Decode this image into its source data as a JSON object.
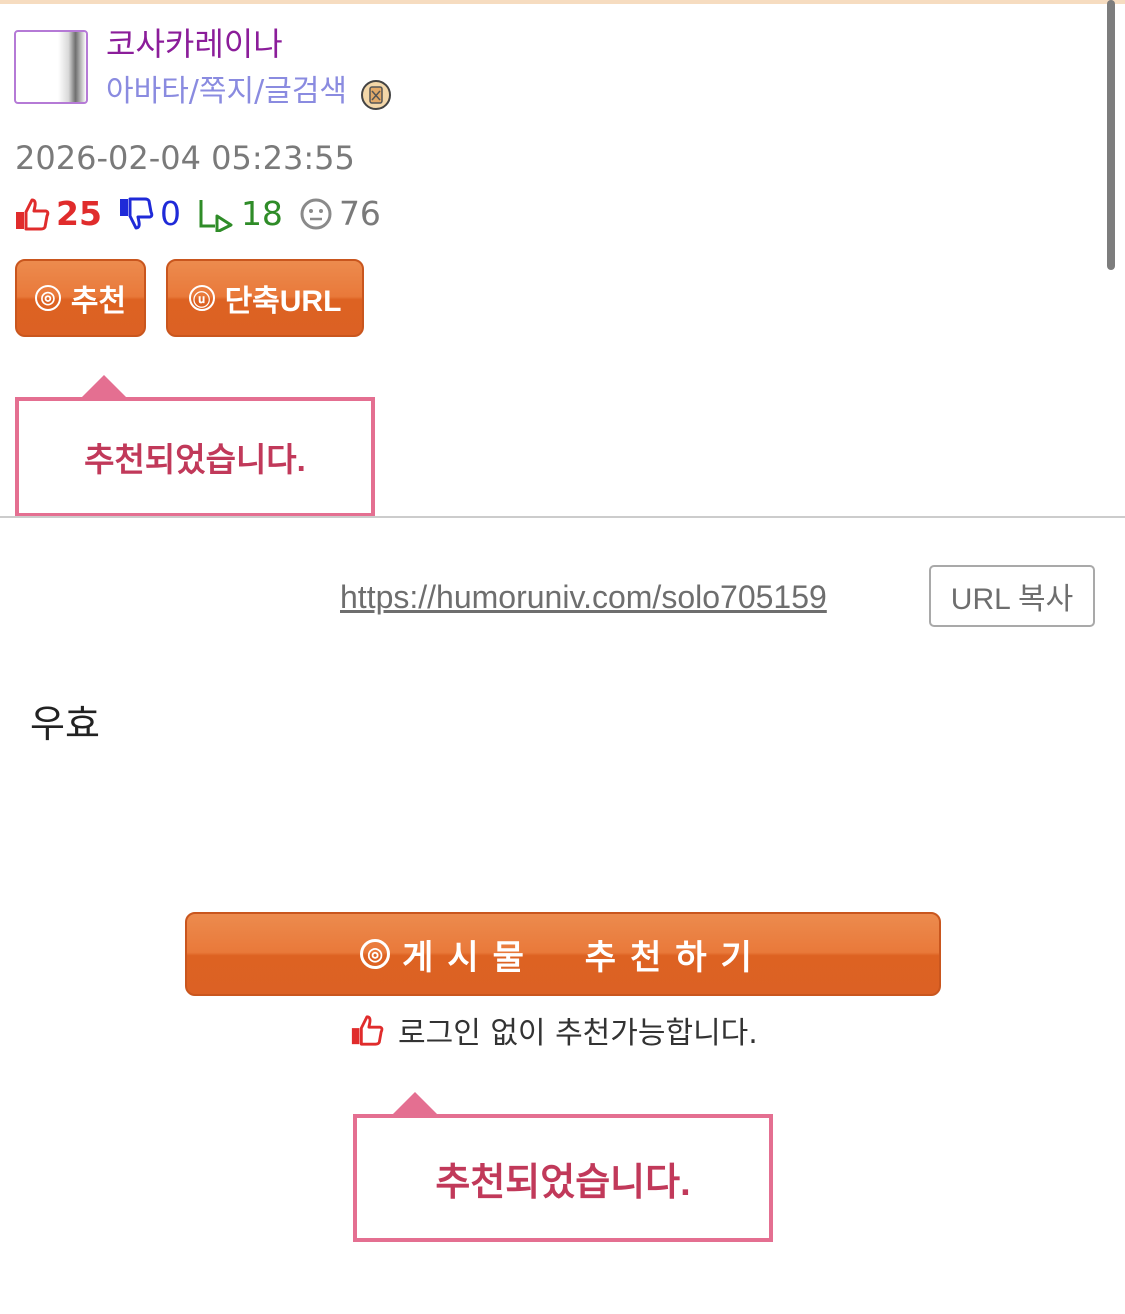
{
  "author": {
    "nickname": "코사카레이나",
    "menu_label": "아바타/쪽지/글검색",
    "avatar_icon": "avatar-image",
    "memo_icon": "memo-icon"
  },
  "post": {
    "datetime": "2026-02-04 05:23:55",
    "stats": {
      "up": "25",
      "down": "0",
      "replies": "18",
      "views": "76"
    },
    "body": "우효"
  },
  "buttons": {
    "recommend_label": "추천",
    "shorturl_label": "단축URL",
    "recommend_icon_glyph": "◎",
    "shorturl_icon_glyph": "ⓤ",
    "copy_url_label": "URL 복사",
    "recommend_post_label": "게시물  추천하기"
  },
  "short_url": "https://humoruniv.com/solo705159",
  "tooltip_message": "추천되었습니다.",
  "nologin_notice": "로그인 없이 추천가능합니다.",
  "colors": {
    "accent_orange": "#e06a2a",
    "nickname_purple": "#8b1d9a",
    "menu_lavender": "#8a8be0",
    "up_red": "#e02c2c",
    "down_blue": "#1f2ad8",
    "reply_green": "#2f8c28",
    "tooltip_pink": "#e46f91"
  }
}
